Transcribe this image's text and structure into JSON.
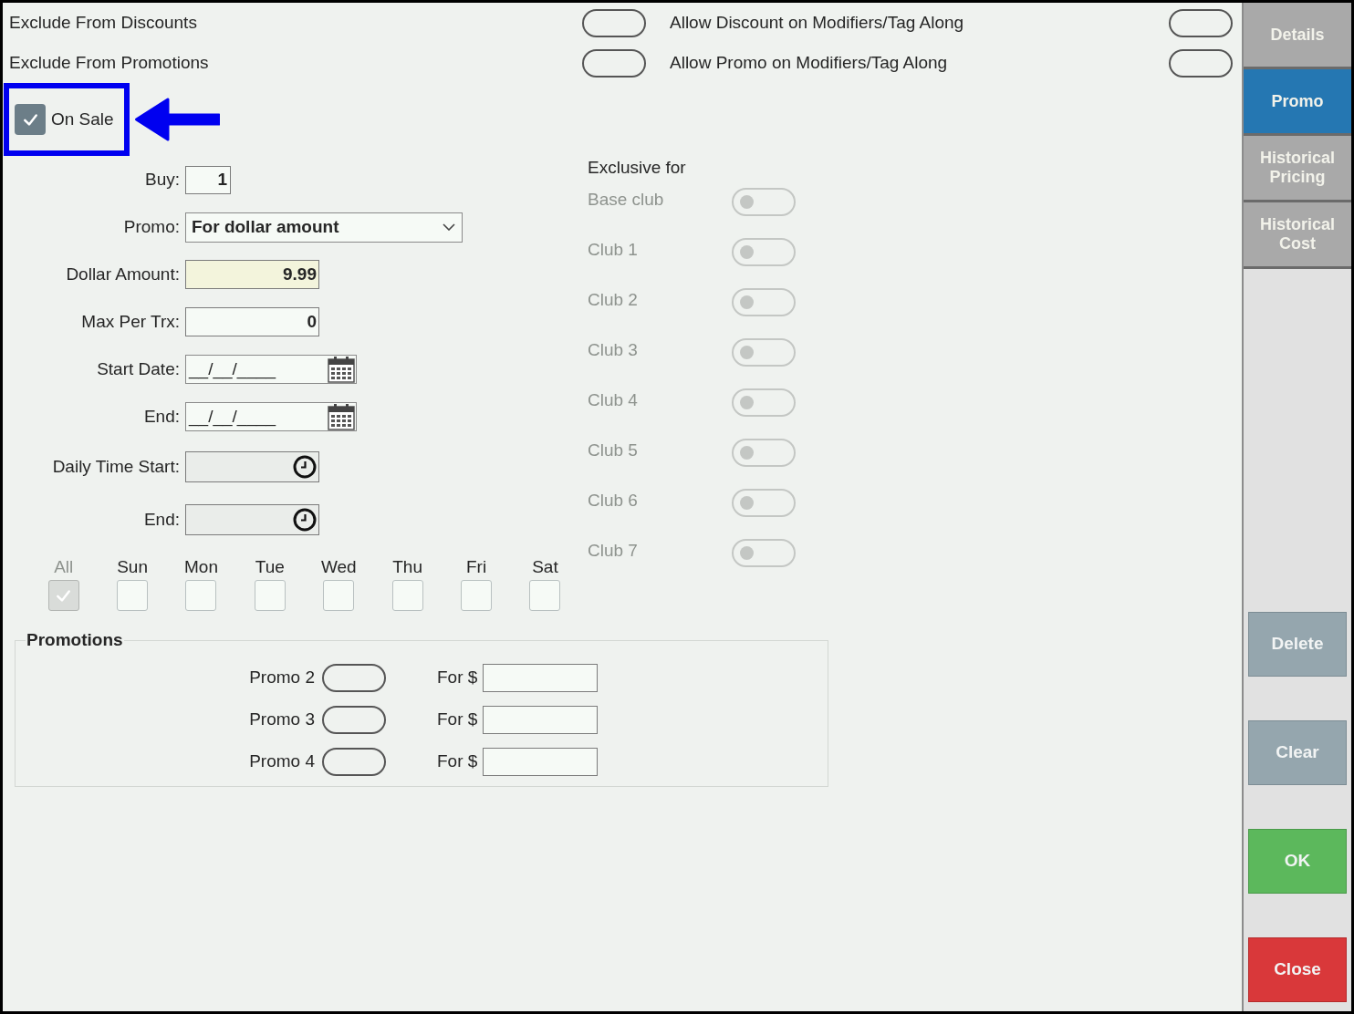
{
  "options": [
    {
      "label": "Exclude From Discounts",
      "on": false
    },
    {
      "label": "Allow Discount on Modifiers/Tag Along",
      "on": false
    },
    {
      "label": "Exclude From Promotions",
      "on": false
    },
    {
      "label": "Allow Promo on Modifiers/Tag Along",
      "on": false
    }
  ],
  "on_sale": {
    "label": "On Sale",
    "checked": true,
    "highlighted": true
  },
  "fields": [
    {
      "kind": "count",
      "label": "Buy:",
      "value": "1",
      "active": false
    },
    {
      "kind": "select",
      "label": "Promo:",
      "value": "For dollar amount",
      "active": false
    },
    {
      "kind": "number",
      "label": "Dollar Amount:",
      "value": "9.99",
      "active": true
    },
    {
      "kind": "number",
      "label": "Max Per Trx:",
      "value": "0",
      "active": false
    },
    {
      "kind": "date",
      "label": "Start Date:",
      "value": "__/__/____",
      "active": false
    },
    {
      "kind": "date",
      "label": "End:",
      "value": "__/__/____",
      "active": false
    },
    {
      "kind": "time",
      "label": "Daily Time Start:",
      "active": false
    },
    {
      "kind": "time",
      "label": "End:",
      "active": false
    }
  ],
  "days": [
    {
      "label": "All",
      "checked": true,
      "disabled": true
    },
    {
      "label": "Sun",
      "checked": false,
      "disabled": false
    },
    {
      "label": "Mon",
      "checked": false,
      "disabled": false
    },
    {
      "label": "Tue",
      "checked": false,
      "disabled": false
    },
    {
      "label": "Wed",
      "checked": false,
      "disabled": false
    },
    {
      "label": "Thu",
      "checked": false,
      "disabled": false
    },
    {
      "label": "Fri",
      "checked": false,
      "disabled": false
    },
    {
      "label": "Sat",
      "checked": false,
      "disabled": false
    }
  ],
  "exclusive": {
    "title": "Exclusive for",
    "clubs": [
      {
        "label": "Base club",
        "on": false,
        "disabled": true
      },
      {
        "label": "Club 1",
        "on": false,
        "disabled": true
      },
      {
        "label": "Club 2",
        "on": false,
        "disabled": true
      },
      {
        "label": "Club 3",
        "on": false,
        "disabled": true
      },
      {
        "label": "Club 4",
        "on": false,
        "disabled": true
      },
      {
        "label": "Club 5",
        "on": false,
        "disabled": true
      },
      {
        "label": "Club 6",
        "on": false,
        "disabled": true
      },
      {
        "label": "Club 7",
        "on": false,
        "disabled": true
      }
    ]
  },
  "promotions": {
    "title": "Promotions",
    "rows": [
      {
        "label": "Promo 2",
        "on": false,
        "amount_label": "For $"
      },
      {
        "label": "Promo 3",
        "on": false,
        "amount_label": "For $"
      },
      {
        "label": "Promo 4",
        "on": false,
        "amount_label": "For $"
      }
    ]
  },
  "tabs": [
    {
      "label": "Details",
      "selected": false
    },
    {
      "label": "Promo",
      "selected": true
    },
    {
      "label": "Historical Pricing",
      "selected": false
    },
    {
      "label": "Historical Cost",
      "selected": false
    }
  ],
  "buttons": [
    {
      "label": "Delete",
      "kind": "neutral"
    },
    {
      "label": "Clear",
      "kind": "neutral"
    },
    {
      "label": "OK",
      "kind": "confirm"
    },
    {
      "label": "Close",
      "kind": "danger"
    }
  ]
}
